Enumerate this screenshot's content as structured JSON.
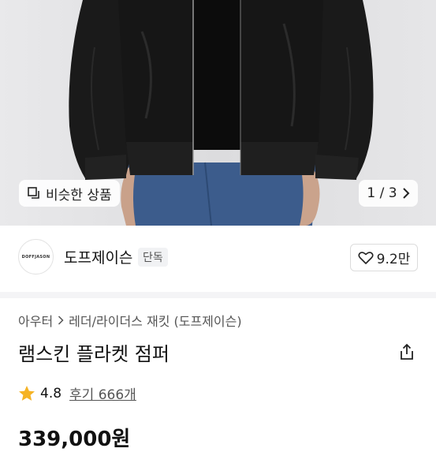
{
  "gallery": {
    "similar_label": "비슷한 상품",
    "counter": "1 / 3"
  },
  "store": {
    "logo_text": "DOFFJASON",
    "name": "도프제이슨",
    "badge": "단독",
    "likes": "9.2만"
  },
  "product": {
    "breadcrumb": [
      "아우터",
      "레더/라이더스 재킷 (도프제이슨)"
    ],
    "title": "램스킨 플라켓 점퍼",
    "rating": "4.8",
    "reviews": "후기 666개",
    "price": "339,000원"
  },
  "colors": {
    "star": "#f5b325",
    "jacket": "#161616",
    "jeans": "#3c5c8c"
  },
  "icons": [
    "copy-icon",
    "chevron-right-icon",
    "heart-icon",
    "share-icon",
    "star-icon"
  ]
}
